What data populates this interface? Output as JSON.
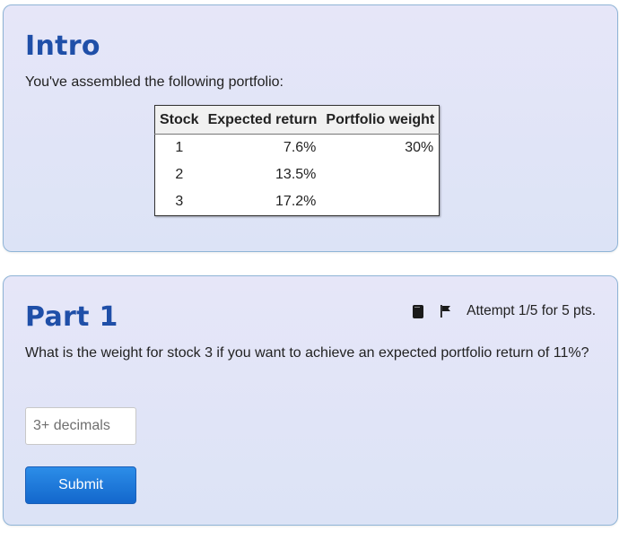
{
  "intro": {
    "title": "Intro",
    "text": "You've assembled the following portfolio:",
    "table": {
      "headers": [
        "Stock",
        "Expected return",
        "Portfolio weight"
      ],
      "rows": [
        [
          "1",
          "7.6%",
          "30%"
        ],
        [
          "2",
          "13.5%",
          ""
        ],
        [
          "3",
          "17.2%",
          ""
        ]
      ]
    }
  },
  "part1": {
    "title": "Part 1",
    "attempt": "Attempt 1/5 for 5 pts.",
    "icons": [
      "notebook-icon",
      "flag-icon"
    ],
    "question": "What is the weight for stock 3 if you want to achieve an expected portfolio return of 11%?",
    "answer_value": "",
    "answer_placeholder": "3+ decimals",
    "submit_label": "Submit"
  },
  "colors": {
    "heading": "#1f4fa8",
    "card_border": "#8fb4d6",
    "button": "#1367cc"
  }
}
